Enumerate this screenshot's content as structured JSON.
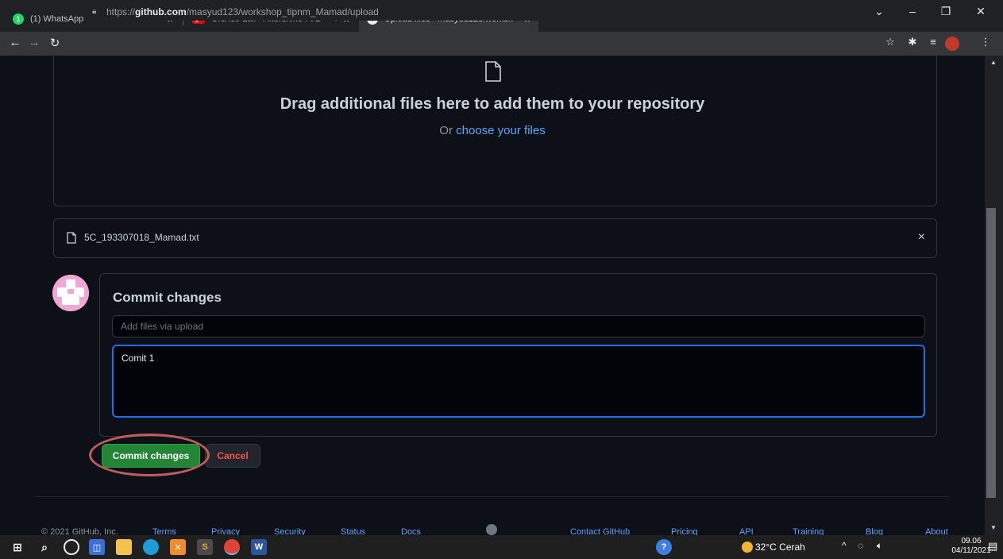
{
  "browser": {
    "tabs": [
      {
        "title": "(1) WhatsApp",
        "close": "×"
      },
      {
        "title": "Ora Iso Lali - Aftershine Ft D",
        "close": "×"
      },
      {
        "title": "Upload files · masyud123/worksh",
        "close": "×"
      }
    ],
    "new_tab": "+",
    "url_prefix": "https://",
    "url_host": "github.com",
    "url_path": "/masyud123/workshop_tipnm_Mamad/upload"
  },
  "upload": {
    "drag_text": "Drag additional files here to add them to your repository",
    "or_text": "Or ",
    "choose_link": "choose your files"
  },
  "file": {
    "name": "5C_193307018_Mamad.txt",
    "remove": "×"
  },
  "commit": {
    "title": "Commit changes",
    "summary_placeholder": "Add files via upload",
    "summary_value": "",
    "description_value": "Comit 1",
    "commit_button": "Commit changes",
    "cancel_button": "Cancel"
  },
  "footer": {
    "copyright": "© 2021 GitHub, Inc.",
    "links": [
      "Terms",
      "Privacy",
      "Security",
      "Status",
      "Docs",
      "Contact GitHub",
      "Pricing",
      "API",
      "Training",
      "Blog",
      "About"
    ]
  },
  "taskbar": {
    "weather": "32°C  Cerah",
    "time": "09.06",
    "date": "04/11/2021"
  }
}
